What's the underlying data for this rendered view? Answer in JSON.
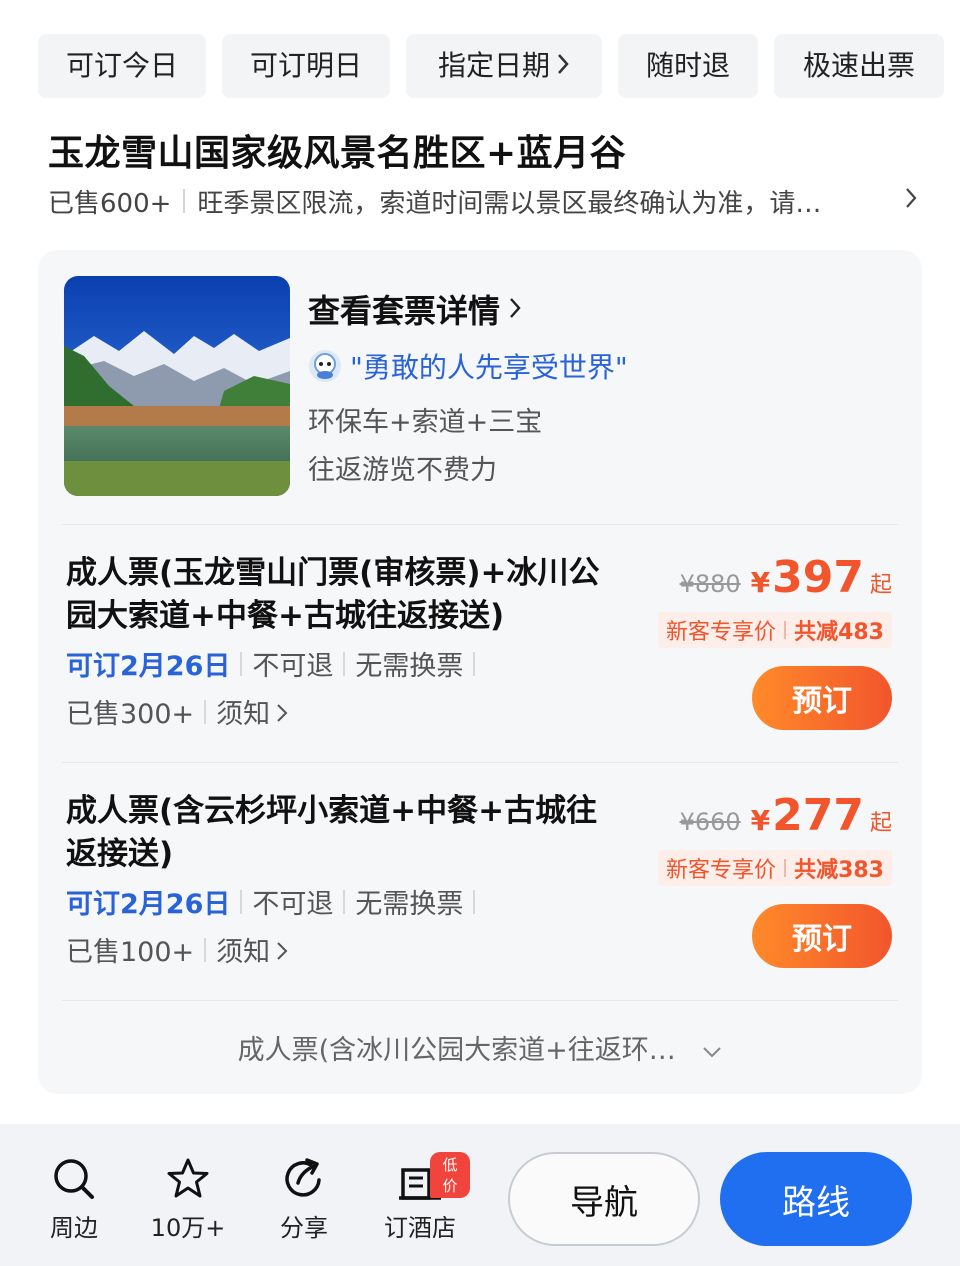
{
  "filters": [
    {
      "label": "可订今日",
      "has_arrow": false
    },
    {
      "label": "可订明日",
      "has_arrow": false
    },
    {
      "label": "指定日期",
      "has_arrow": true
    },
    {
      "label": "随时退",
      "has_arrow": false
    },
    {
      "label": "极速出票",
      "has_arrow": false
    }
  ],
  "attraction": {
    "title": "玉龙雪山国家级风景名胜区+蓝月谷",
    "sold": "已售600+",
    "notice": "旺季景区限流，索道时间需以景区最终确认为准，请…"
  },
  "package": {
    "title": "查看套票详情",
    "quote": "\"勇敢的人先享受世界\"",
    "desc_line1": "环保车+索道+三宝",
    "desc_line2": "往返游览不费力"
  },
  "tickets": [
    {
      "name": "成人票(玉龙雪山门票(审核票)+冰川公园大索道+中餐+古城往返接送)",
      "date": "可订2月26日",
      "refund": "不可退",
      "exchange": "无需换票",
      "sold": "已售300+",
      "notice_link": "须知",
      "original_price": "¥880",
      "currency": "¥",
      "price": "397",
      "price_suffix": "起",
      "promo_label": "新客专享价",
      "promo_discount": "共减483",
      "button": "预订"
    },
    {
      "name": "成人票(含云杉坪小索道+中餐+古城往返接送)",
      "date": "可订2月26日",
      "refund": "不可退",
      "exchange": "无需换票",
      "sold": "已售100+",
      "notice_link": "须知",
      "original_price": "¥660",
      "currency": "¥",
      "price": "277",
      "price_suffix": "起",
      "promo_label": "新客专享价",
      "promo_discount": "共减383",
      "button": "预订"
    }
  ],
  "more_ticket": "成人票(含冰川公园大索道+往返环…",
  "bottom_bar": {
    "nearby": "周边",
    "favorites": "10万+",
    "share": "分享",
    "hotel": "订酒店",
    "hotel_badge": "低价",
    "navigate": "导航",
    "route": "路线"
  },
  "colors": {
    "accent_blue": "#2a62d8",
    "price_orange": "#f2552c",
    "route_blue": "#1f6ff0"
  }
}
